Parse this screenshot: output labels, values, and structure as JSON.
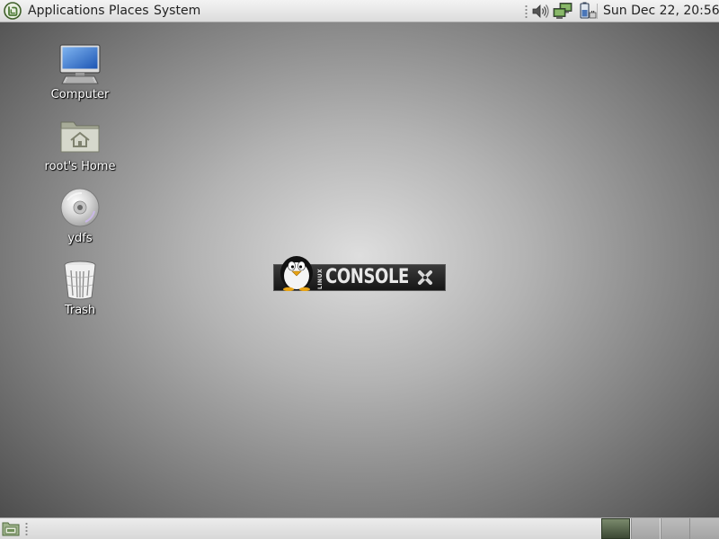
{
  "top_panel": {
    "menus": {
      "applications": "Applications",
      "places": "Places",
      "system": "System"
    },
    "tray_icons": [
      "volume-icon",
      "network-icon",
      "power-icon"
    ],
    "clock": "Sun Dec 22, 20:56"
  },
  "desktop": {
    "icons": [
      {
        "label": "Computer",
        "icon": "computer-icon"
      },
      {
        "label": "root's Home",
        "icon": "home-folder-icon"
      },
      {
        "label": "ydfs",
        "icon": "disc-icon"
      },
      {
        "label": "Trash",
        "icon": "trash-icon"
      }
    ],
    "logo": {
      "small_text": "LINUX",
      "main_text": "CONSOLE"
    }
  },
  "bottom_panel": {
    "workspaces": 4,
    "active_workspace": 1
  },
  "colors": {
    "accent_green": "#4d7a36",
    "active_workspace": "#3c4834"
  }
}
